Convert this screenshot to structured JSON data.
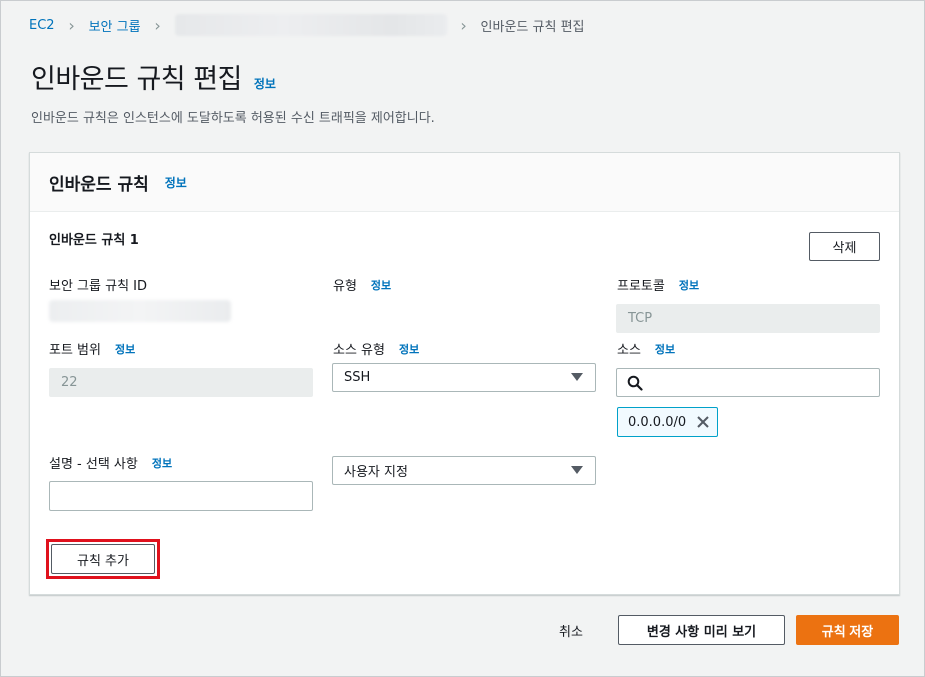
{
  "breadcrumb": {
    "root": "EC2",
    "security_groups": "보안 그룹",
    "current": "인바운드 규칙 편집"
  },
  "page": {
    "title": "인바운드 규칙 편집",
    "info": "정보",
    "description": "인바운드 규칙은 인스턴스에 도달하도록 허용된 수신 트래픽을 제어합니다."
  },
  "panel": {
    "title": "인바운드 규칙",
    "info": "정보"
  },
  "rule": {
    "title": "인바운드 규칙 1",
    "delete_label": "삭제",
    "sg_rule_id_label": "보안 그룹 규칙 ID",
    "type_label": "유형",
    "type_info": "정보",
    "type_value": "SSH",
    "protocol_label": "프로토콜",
    "protocol_info": "정보",
    "protocol_value": "TCP",
    "port_label": "포트 범위",
    "port_info": "정보",
    "port_value": "22",
    "source_type_label": "소스 유형",
    "source_type_info": "정보",
    "source_type_value": "사용자 지정",
    "source_label": "소스",
    "source_info": "정보",
    "source_search_value": "",
    "source_token": "0.0.0.0/0",
    "description_label": "설명 - 선택 사항",
    "description_info": "정보",
    "description_value": ""
  },
  "actions": {
    "add_rule": "규칙 추가",
    "cancel": "취소",
    "preview": "변경 사항 미리 보기",
    "save": "규칙 저장"
  },
  "colors": {
    "link": "#0073bb",
    "primary": "#ec7211",
    "highlight": "#e0111d",
    "token_border": "#00a1c9"
  }
}
